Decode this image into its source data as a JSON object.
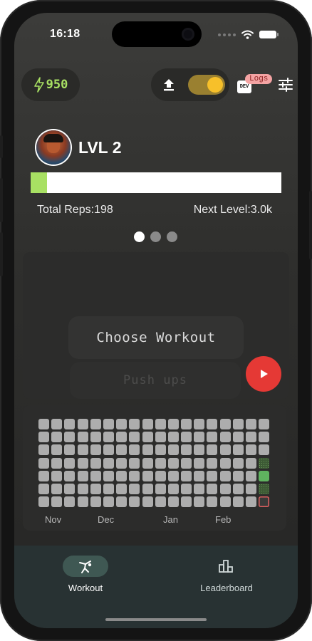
{
  "status": {
    "time": "16:18"
  },
  "energy": {
    "value": "950"
  },
  "header": {
    "dev_label": "DEV",
    "logs_label": "Logs"
  },
  "profile": {
    "level_title": "LVL 2",
    "xp_progress": 0.065,
    "total_reps_label": "Total Reps:198",
    "next_level_label": "Next Level:3.0k"
  },
  "carousel": {
    "pages": 3,
    "active": 0
  },
  "workout": {
    "choose_label": "Choose Workout",
    "selected_label": "Push ups"
  },
  "heatmap": {
    "months": [
      "Nov",
      "Dec",
      "Jan",
      "Feb"
    ]
  },
  "tabs": {
    "workout_label": "Workout",
    "leaderboard_label": "Leaderboard"
  },
  "colors": {
    "accent_green": "#a8e063",
    "toggle_yellow": "#f7c02a",
    "play_red": "#e53935",
    "logs_badge": "#f4a3a3"
  },
  "icons": {
    "energy": "lightning-bolt-icon",
    "upload": "upload-icon",
    "settings": "tune-sliders-icon",
    "play": "play-icon",
    "workout_tab": "figure-icon",
    "leaderboard_tab": "podium-icon"
  }
}
